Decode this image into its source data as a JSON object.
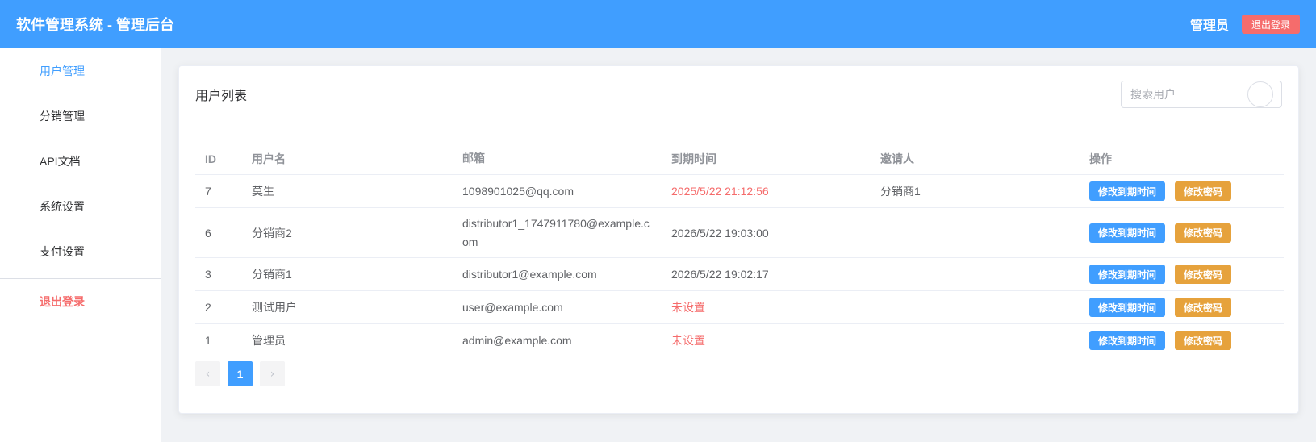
{
  "header": {
    "title": "软件管理系统 - 管理后台",
    "user": "管理员",
    "logout_label": "退出登录"
  },
  "sidebar": {
    "items": [
      {
        "label": "用户管理",
        "active": true
      },
      {
        "label": "分销管理"
      },
      {
        "label": "API文档"
      },
      {
        "label": "系统设置"
      },
      {
        "label": "支付设置"
      }
    ],
    "logout_label": "退出登录"
  },
  "card": {
    "title": "用户列表",
    "search_placeholder": "搜索用户"
  },
  "table": {
    "columns": [
      "ID",
      "用户名",
      "邮箱",
      "到期时间",
      "邀请人",
      "操作"
    ],
    "rows": [
      {
        "id": "7",
        "name": "莫生",
        "email": "1098901025@qq.com",
        "expire": "2025/5/22 21:12:56",
        "inviter": "分销商1"
      },
      {
        "id": "6",
        "name": "分销商2",
        "email": "distributor1_1747911780@example.com",
        "expire": "2026/5/22 19:03:00",
        "inviter": ""
      },
      {
        "id": "3",
        "name": "分销商1",
        "email": "distributor1@example.com",
        "expire": "2026/5/22 19:02:17",
        "inviter": ""
      },
      {
        "id": "2",
        "name": "测试用户",
        "email": "user@example.com",
        "expire": "未设置",
        "inviter": ""
      },
      {
        "id": "1",
        "name": "管理员",
        "email": "admin@example.com",
        "expire": "未设置",
        "inviter": ""
      }
    ],
    "action_modify_expire": "修改到期时间",
    "action_modify_password": "修改密码"
  },
  "pagination": {
    "prev_icon": "‹",
    "current": "1",
    "next_icon": "›"
  },
  "colors": {
    "primary": "#409eff",
    "danger": "#f56c6c",
    "warning": "#e6a23c"
  }
}
